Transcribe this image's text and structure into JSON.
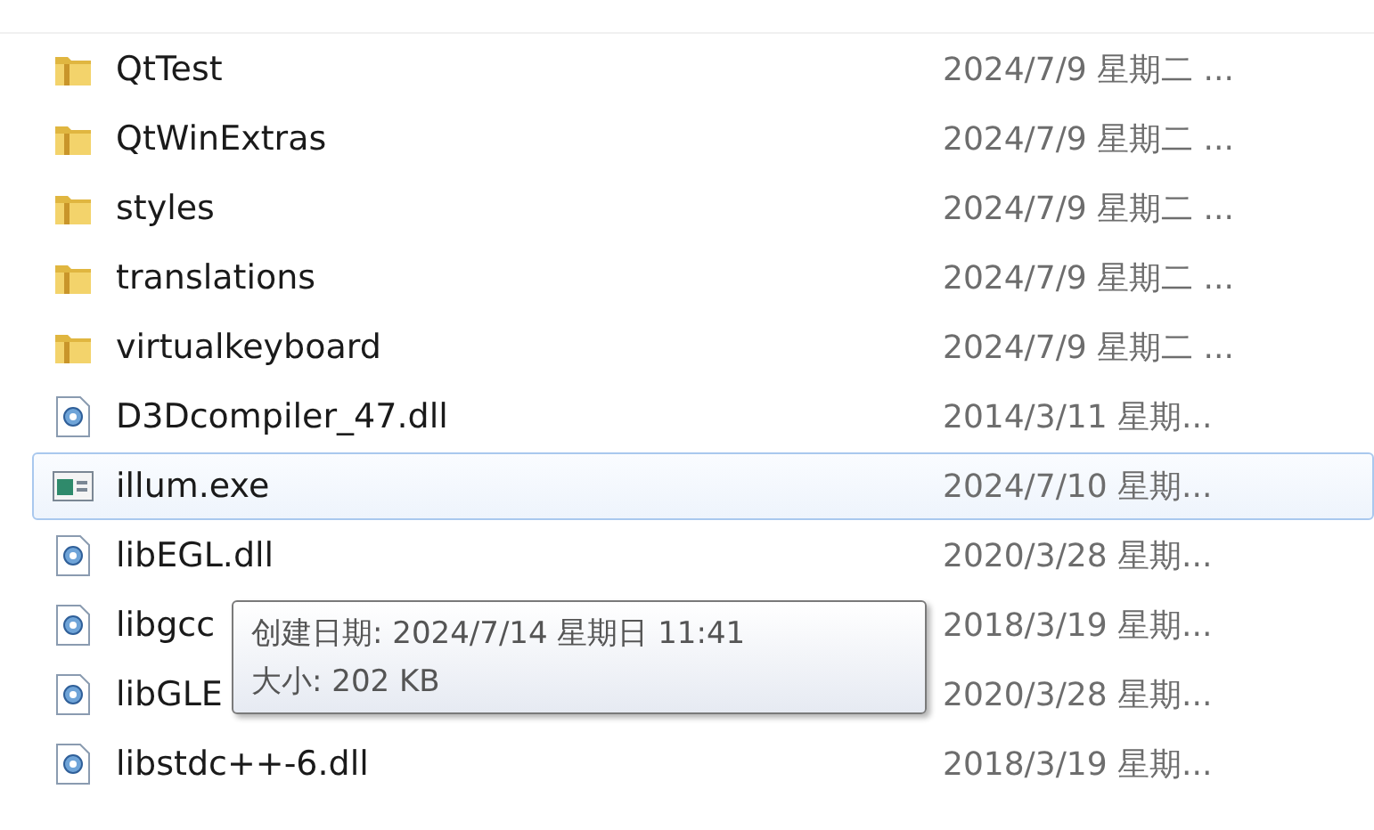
{
  "files": [
    {
      "name": "QtTest",
      "kind": "folder",
      "date": "2024/7/9 星期二 ...",
      "selected": false
    },
    {
      "name": "QtWinExtras",
      "kind": "folder",
      "date": "2024/7/9 星期二 ...",
      "selected": false
    },
    {
      "name": "styles",
      "kind": "folder",
      "date": "2024/7/9 星期二 ...",
      "selected": false
    },
    {
      "name": "translations",
      "kind": "folder",
      "date": "2024/7/9 星期二 ...",
      "selected": false
    },
    {
      "name": "virtualkeyboard",
      "kind": "folder",
      "date": "2024/7/9 星期二 ...",
      "selected": false
    },
    {
      "name": "D3Dcompiler_47.dll",
      "kind": "dll",
      "date": "2014/3/11 星期...",
      "selected": false
    },
    {
      "name": "illum.exe",
      "kind": "exe",
      "date": "2024/7/10 星期...",
      "selected": true
    },
    {
      "name": "libEGL.dll",
      "kind": "dll",
      "date": "2020/3/28 星期...",
      "selected": false
    },
    {
      "name": "libgcc",
      "kind": "dll",
      "date": "2018/3/19 星期...",
      "selected": false
    },
    {
      "name": "libGLE",
      "kind": "dll",
      "date": "2020/3/28 星期...",
      "selected": false
    },
    {
      "name": "libstdc++-6.dll",
      "kind": "dll",
      "date": "2018/3/19 星期...",
      "selected": false
    }
  ],
  "tooltip": {
    "lines": [
      "创建日期: 2024/7/14 星期日 11:41",
      "大小: 202 KB"
    ]
  }
}
